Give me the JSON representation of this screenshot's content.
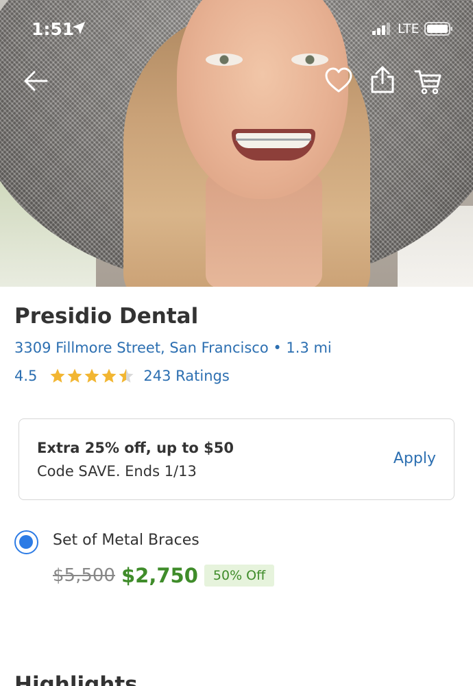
{
  "status_bar": {
    "time": "1:51",
    "network": "LTE",
    "icons": [
      "location-arrow-icon",
      "signal-icon",
      "battery-icon"
    ]
  },
  "nav": {
    "icons": [
      "back-arrow-icon",
      "heart-icon",
      "share-icon",
      "cart-icon"
    ]
  },
  "business": {
    "name": "Presidio Dental",
    "address": "3309 Fillmore Street, San Francisco • 1.3 mi",
    "rating": "4.5",
    "rating_value": 4.5,
    "rating_max": 5,
    "ratings_count": "243 Ratings"
  },
  "promo": {
    "title": "Extra 25% off, up to $50",
    "subtitle": "Code SAVE. Ends 1/13",
    "apply_label": "Apply"
  },
  "option": {
    "label": "Set of Metal Braces",
    "selected": true,
    "original_price": "$5,500",
    "sale_price": "$2,750",
    "discount_badge": "50% Off"
  },
  "section": {
    "highlights_title": "Highlights"
  },
  "colors": {
    "link_blue": "#2c6fb1",
    "price_green": "#3f8c2a",
    "badge_bg": "#e6f3dc",
    "star_gold": "#f2b632",
    "radio_blue": "#2c7be5"
  }
}
